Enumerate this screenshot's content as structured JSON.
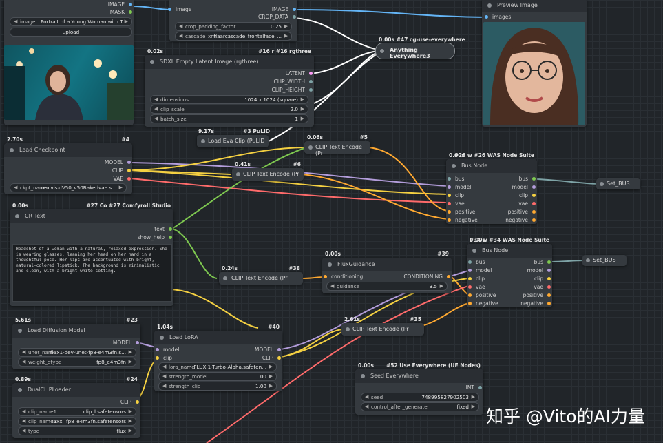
{
  "load_image": {
    "outputs": [
      "IMAGE",
      "MASK"
    ],
    "image_label": "image",
    "image_value": "Portrait of a Young Woman with T...",
    "upload_label": "upload"
  },
  "face_crop": {
    "inputs": [
      "image"
    ],
    "outputs": [
      "IMAGE",
      "CROP_DATA"
    ],
    "crop_padding_label": "crop_padding_factor",
    "crop_padding_value": "0.25",
    "cascade_label": "cascade_xml",
    "cascade_value": "haarcascade_frontalface_..."
  },
  "preview": {
    "title": "Preview Image",
    "input": "images"
  },
  "anything_everywhere": {
    "time": "0.00s",
    "id": "#47 cg-use-everywhere",
    "title": "Anything Everywhere3"
  },
  "sdxl_latent": {
    "time": "0.02s",
    "id_short": "#16 r",
    "id": "#16 rgthree",
    "title": "SDXL Empty Latent Image (rgthree)",
    "outputs": [
      "LATENT",
      "CLIP_WIDTH",
      "CLIP_HEIGHT"
    ],
    "dimensions_label": "dimensions",
    "dimensions_value": "1024 x 1024  (square)",
    "clip_scale_label": "clip_scale",
    "clip_scale_value": "2.0",
    "batch_label": "batch_size",
    "batch_value": "1"
  },
  "load_eva": {
    "time": "9.17s",
    "id": "#3 PuLID",
    "title": "Load Eva Clip (PuLID"
  },
  "load_checkpoint": {
    "time": "2.70s",
    "id": "#4",
    "title": "Load Checkpoint",
    "outputs": [
      "MODEL",
      "CLIP",
      "VAE"
    ],
    "ckpt_label": "ckpt_name",
    "ckpt_value": "realvisxlV50_v50Bakedvae.s..."
  },
  "clip_encode_5": {
    "time": "0.06s",
    "id": "#5",
    "title": "CLIP Text Encode (Pr"
  },
  "clip_encode_6": {
    "time": "0.41s",
    "id": "#6",
    "title": "CLIP Text Encode (Pr"
  },
  "bus_26": {
    "time": "0.00s",
    "id_short": "#26 w",
    "id": "#26 WAS Node Suite",
    "title": "Bus Node",
    "inputs": [
      "bus",
      "model",
      "clip",
      "vae",
      "positive",
      "negative"
    ],
    "outputs": [
      "bus",
      "model",
      "clip",
      "vae",
      "positive",
      "negative"
    ]
  },
  "set_bus_1": {
    "title": "Set_BUS"
  },
  "cr_text": {
    "time": "0.00s",
    "id_short": "#27 Co",
    "id": "#27 Comfyroll Studio",
    "title": "CR Text",
    "outputs": [
      "text",
      "show_help"
    ],
    "text": "Headshot of a woman with a natural, relaxed expression. She is wearing glasses, leaning her head on her hand in a thoughtful pose. Her lips are accentuated with bright, natural-colored lipstick. The background is minimalistic and clean, with a bright white setting."
  },
  "bus_34": {
    "time": "0.00s",
    "id_short": "#34 w",
    "id": "#34 WAS Node Suite",
    "title": "Bus Node",
    "inputs": [
      "bus",
      "model",
      "clip",
      "vae",
      "positive",
      "negative"
    ],
    "outputs": [
      "bus",
      "model",
      "clip",
      "vae",
      "positive",
      "negative"
    ]
  },
  "set_bus_2": {
    "title": "Set_BUS"
  },
  "flux_guidance": {
    "time": "0.00s",
    "id": "#39",
    "title": "FluxGuidance",
    "input": "conditioning",
    "output": "CONDITIONING",
    "guidance_label": "guidance",
    "guidance_value": "3.5"
  },
  "clip_encode_38": {
    "time": "0.24s",
    "id": "#38",
    "title": "CLIP Text Encode (Pr"
  },
  "load_diffusion": {
    "time": "5.61s",
    "id": "#23",
    "title": "Load Diffusion Model",
    "output": "MODEL",
    "unet_label": "unet_name",
    "unet_value": "flux1-dev-unet-fp8-e4m3fn.s...",
    "dtype_label": "weight_dtype",
    "dtype_value": "fp8_e4m3fn"
  },
  "load_lora": {
    "time": "1.04s",
    "id": "#40",
    "title": "Load LoRA",
    "inputs": [
      "model",
      "clip"
    ],
    "outputs": [
      "MODEL",
      "CLIP"
    ],
    "lora_label": "lora_name",
    "lora_value": "FLUX.1-Turbo-Alpha.safeten...",
    "strength_model_label": "strength_model",
    "strength_model_value": "1.00",
    "strength_clip_label": "strength_clip",
    "strength_clip_value": "1.00"
  },
  "clip_encode_35": {
    "time": "2.61s",
    "id": "#35",
    "title": "CLIP Text Encode (Pr"
  },
  "dual_clip": {
    "time": "0.89s",
    "id": "#24",
    "title": "DualCLIPLoader",
    "output": "CLIP",
    "clip1_label": "clip_name1",
    "clip1_value": "clip_l.safetensors",
    "clip2_label": "clip_name2",
    "clip2_value": "t5xxl_fp8_e4m3fn.safetensors",
    "type_label": "type",
    "type_value": "flux"
  },
  "seed": {
    "time": "0.00s",
    "id": "#52 Use Everywhere (UE Nodes)",
    "title": "Seed Everywhere",
    "output": "INT",
    "seed_label": "seed",
    "seed_value": "748995827902503",
    "control_label": "control_after_generate",
    "control_value": "fixed"
  },
  "watermark": "知乎 @Vito的AI力量",
  "colors": {
    "model": "#b39ddb",
    "clip": "#f5d142",
    "vae": "#ff6b6b",
    "cond": "#ffa931",
    "image": "#64b5f6",
    "latent": "#ff9cf9",
    "string": "#7ec850",
    "white": "#ffffff"
  }
}
